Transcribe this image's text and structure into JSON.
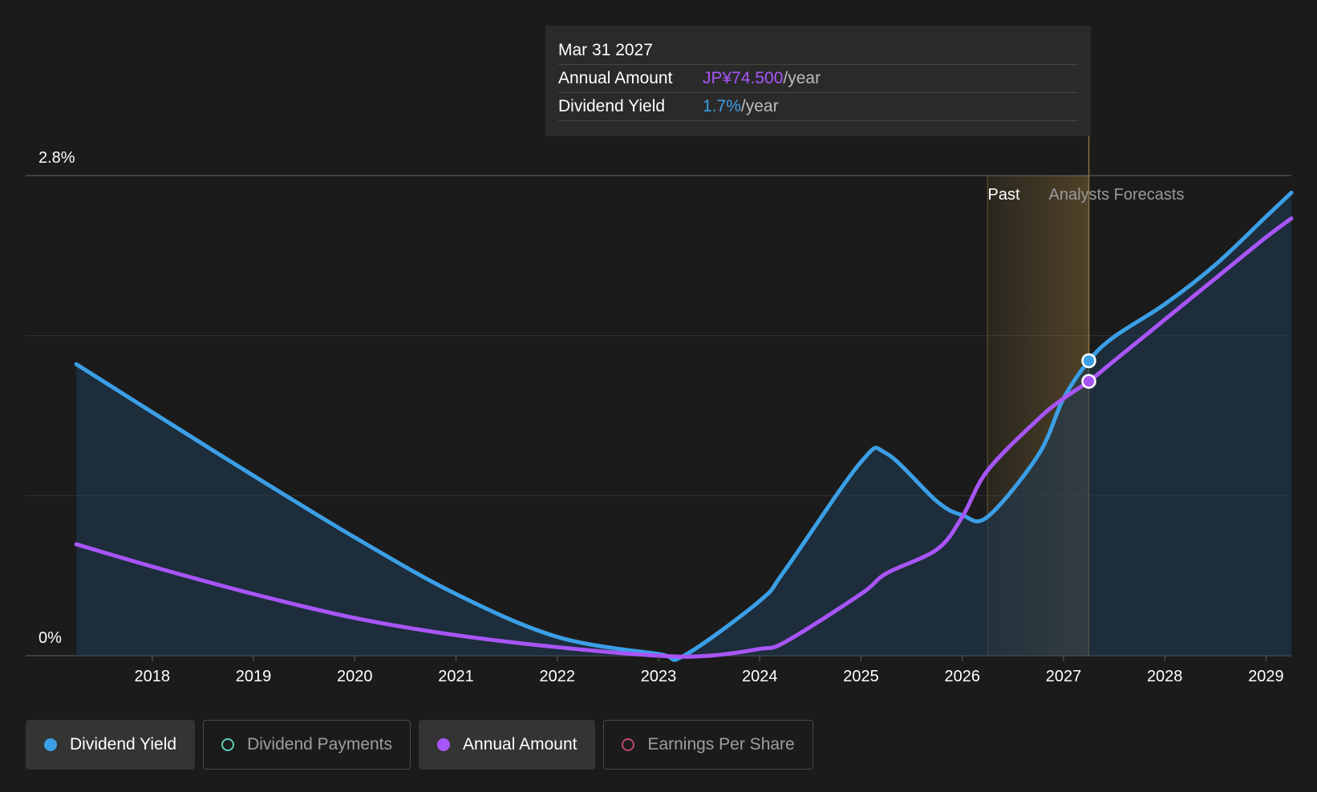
{
  "tooltip": {
    "date": "Mar 31 2027",
    "rows": [
      {
        "label": "Annual Amount",
        "value": "JP¥74.500",
        "unit": "/year",
        "color": "#a855f7"
      },
      {
        "label": "Dividend Yield",
        "value": "1.7%",
        "unit": "/year",
        "color": "#3b9fe6"
      }
    ]
  },
  "legend": [
    {
      "label": "Dividend Yield",
      "color": "#3b9fe6",
      "active": true,
      "filled": true
    },
    {
      "label": "Dividend Payments",
      "color": "#5fd0b8",
      "active": false,
      "filled": false
    },
    {
      "label": "Annual Amount",
      "color": "#a855f7",
      "active": true,
      "filled": true
    },
    {
      "label": "Earnings Per Share",
      "color": "#c2477a",
      "active": false,
      "filled": false
    }
  ],
  "chart_data": {
    "type": "line",
    "y_top_label": "2.8%",
    "y_bottom_label": "0%",
    "ylim": [
      0,
      2.8
    ],
    "xlim": [
      2016.75,
      2029.25
    ],
    "x_ticks": [
      "2018",
      "2019",
      "2020",
      "2021",
      "2022",
      "2023",
      "2024",
      "2025",
      "2026",
      "2027",
      "2028",
      "2029"
    ],
    "grid": true,
    "past_label": "Past",
    "forecast_label": "Analysts Forecasts",
    "past_region": [
      2026.25,
      2027.25
    ],
    "hover_x": 2027.25,
    "series": [
      {
        "name": "Dividend Yield",
        "color": "#3b9fe6",
        "fill": true,
        "x": [
          2017.25,
          2018,
          2019,
          2020,
          2021,
          2022,
          2023,
          2023.25,
          2024,
          2024.25,
          2025,
          2025.25,
          2025.75,
          2026,
          2026.25,
          2026.75,
          2027,
          2027.25,
          2027.5,
          2028,
          2028.5,
          2029,
          2029.25
        ],
        "y": [
          1.7,
          1.42,
          1.05,
          0.69,
          0.36,
          0.11,
          0.01,
          0.0,
          0.32,
          0.5,
          1.13,
          1.18,
          0.9,
          0.82,
          0.81,
          1.17,
          1.5,
          1.72,
          1.86,
          2.05,
          2.28,
          2.56,
          2.7
        ]
      },
      {
        "name": "Annual Amount",
        "color": "#a855f7",
        "fill": false,
        "x": [
          2017.25,
          2018,
          2019,
          2020,
          2021,
          2022,
          2023,
          2023.5,
          2024,
          2024.25,
          2025,
          2025.25,
          2025.75,
          2026,
          2026.25,
          2026.75,
          2027,
          2027.25,
          2027.5,
          2028,
          2028.5,
          2029,
          2029.25
        ],
        "y": [
          0.65,
          0.52,
          0.36,
          0.22,
          0.12,
          0.05,
          0.0,
          0.0,
          0.04,
          0.08,
          0.36,
          0.48,
          0.62,
          0.81,
          1.08,
          1.38,
          1.5,
          1.6,
          1.72,
          1.96,
          2.2,
          2.44,
          2.55
        ]
      }
    ]
  }
}
